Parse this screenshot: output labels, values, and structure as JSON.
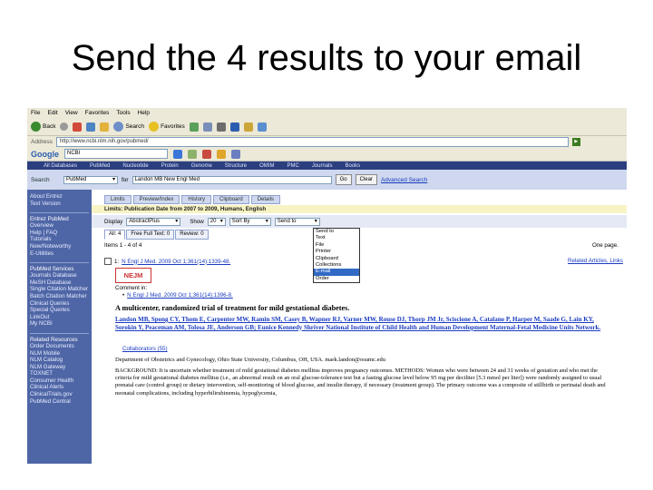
{
  "slide": {
    "title": "Send the 4 results to your email"
  },
  "browser": {
    "menu": [
      "File",
      "Edit",
      "View",
      "Favorites",
      "Tools",
      "Help"
    ],
    "toolbar": {
      "back": "Back",
      "search": "Search",
      "favorites": "Favorites"
    },
    "address_label": "Address",
    "address_value": "http://www.ncbi.nlm.nih.gov/pubmed/",
    "google_label": "Google",
    "google_query": "NCBI"
  },
  "ncbi": {
    "nav": [
      "All Databases",
      "PubMed",
      "Nucleotide",
      "Protein",
      "Genome",
      "Structure",
      "OMIM",
      "PMC",
      "Journals",
      "Books"
    ],
    "search_label": "Search",
    "search_db": "PubMed",
    "for_label": "for",
    "query": "Landon MB New Engl Med",
    "go": "Go",
    "clear": "Clear",
    "advanced": "Advanced Search"
  },
  "sidebar": {
    "top": [
      "About Entrez",
      "Text Version"
    ],
    "sections": [
      {
        "title": "Entrez PubMed",
        "items": [
          "Overview",
          "Help | FAQ",
          "Tutorials",
          "New/Noteworthy",
          "E-Utilities"
        ]
      },
      {
        "title": "PubMed Services",
        "items": [
          "Journals Database",
          "MeSH Database",
          "Single Citation Matcher",
          "Batch Citation Matcher",
          "Clinical Queries",
          "Special Queries",
          "LinkOut",
          "My NCBI"
        ]
      },
      {
        "title": "Related Resources",
        "items": [
          "Order Documents",
          "NLM Mobile",
          "NLM Catalog",
          "NLM Gateway",
          "TOXNET",
          "Consumer Health",
          "Clinical Alerts",
          "ClinicalTrials.gov",
          "PubMed Central"
        ]
      }
    ]
  },
  "main": {
    "tabs": [
      "Limits",
      "Preview/Index",
      "History",
      "Clipboard",
      "Details"
    ],
    "limits_text": "Limits: Publication Date from 2007 to 2009, Humans, English",
    "display": {
      "label": "Display",
      "format": "AbstractPlus",
      "show_label": "Show",
      "show_value": "20",
      "sort_value": "Sort By",
      "sendto_value": "Send to"
    },
    "sendto_options": [
      "Send to",
      "Text",
      "File",
      "Printer",
      "Clipboard",
      "Collections",
      "E-mail",
      "Order"
    ],
    "sendto_selected": "E-mail",
    "subtabs": [
      "All: 4",
      "Free Full Text: 0",
      "Review: 0"
    ],
    "items_text": "Items 1 - 4 of 4",
    "one_page": "One page.",
    "result": {
      "number": "1:",
      "citation": "N Engl J Med. 2009 Oct 1;361(14):1339-48.",
      "related": "Related Articles, Links",
      "journal_badge": "NEJM",
      "comment_label": "Comment in:",
      "comment": "N Engl J Med. 2009 Oct 1;361(14):1396-8.",
      "title": "A multicenter, randomized trial of treatment for mild gestational diabetes.",
      "authors": "Landon MB, Spong CY, Thom E, Carpenter MW, Ramin SM, Casey B, Wapner RJ, Varner MW, Rouse DJ, Thorp JM Jr, Sciscione A, Catalano P, Harper M, Saade G, Lain KY, Sorokin Y, Peaceman AM, Tolosa JE, Anderson GB; Eunice Kennedy Shriver National Institute of Child Health and Human Development Maternal-Fetal Medicine Units Network.",
      "collab": "Collaborators (55)",
      "affiliation": "Department of Obstetrics and Gynecology, Ohio State University, Columbus, OH, USA. mark.landon@osumc.edu",
      "abstract": "BACKGROUND: It is uncertain whether treatment of mild gestational diabetes mellitus improves pregnancy outcomes. METHODS: Women who were between 24 and 31 weeks of gestation and who met the criteria for mild gestational diabetes mellitus (i.e., an abnormal result on an oral glucose-tolerance test but a fasting glucose level below 95 mg per deciliter [5.3 mmol per liter]) were randomly assigned to usual prenatal care (control group) or dietary intervention, self-monitoring of blood glucose, and insulin therapy, if necessary (treatment group). The primary outcome was a composite of stillbirth or perinatal death and neonatal complications, including hyperbilirubinemia, hypoglycemia,"
    }
  }
}
